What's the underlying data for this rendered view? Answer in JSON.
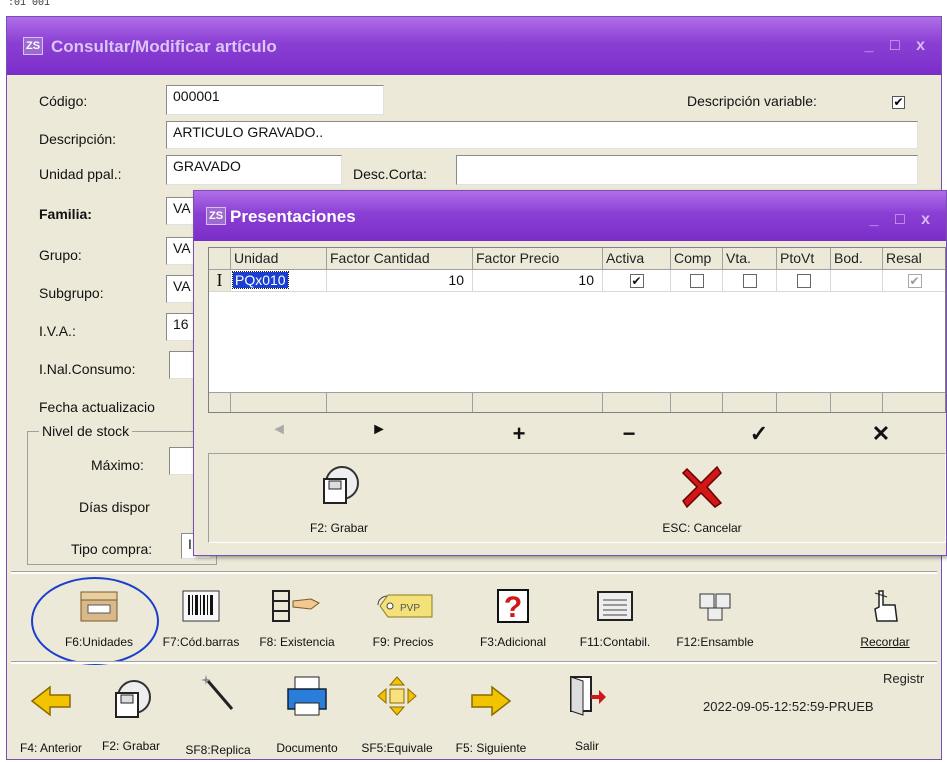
{
  "top_fragment": ":01 001",
  "main": {
    "title": "Consultar/Modificar artículo",
    "icon_text": "ZS",
    "window_buttons": "_ □ x",
    "fields": {
      "codigo_label": "Código:",
      "codigo_value": "000001",
      "desc_variable_label": "Descripción variable:",
      "desc_variable_checked": "✔",
      "descripcion_label": "Descripción:",
      "descripcion_value": "ARTICULO GRAVADO..",
      "unidad_label": "Unidad ppal.:",
      "unidad_value": "GRAVADO",
      "desc_corta_label": "Desc.Corta:",
      "desc_corta_value": "",
      "familia_label": "Familia:",
      "familia_value": "VA",
      "grupo_label": "Grupo:",
      "grupo_value": "VA",
      "subgrupo_label": "Subgrupo:",
      "subgrupo_value": "VA",
      "iva_label": "I.V.A.:",
      "iva_value": "16",
      "consumo_label": "I.Nal.Consumo:",
      "fecha_label": "Fecha actualizacio",
      "nivel_stock_label": "Nivel de stock",
      "maximo_label": "Máximo:",
      "dias_label": "Días dispor",
      "tipo_compra_label": "Tipo compra:",
      "tipo_compra_value": "I"
    },
    "toolbar1": [
      {
        "key": "units",
        "label": "F6:Unidades"
      },
      {
        "key": "barcode",
        "label": "F7:Cód.barras"
      },
      {
        "key": "stock",
        "label": "F8: Existencia"
      },
      {
        "key": "prices",
        "label": "F9: Precios"
      },
      {
        "key": "additional",
        "label": "F3:Adicional"
      },
      {
        "key": "accounting",
        "label": "F11:Contabil."
      },
      {
        "key": "assembly",
        "label": "F12:Ensamble"
      },
      {
        "key": "remind",
        "label": "Recordar"
      }
    ],
    "toolbar2": [
      {
        "key": "prev",
        "label": "F4: Anterior"
      },
      {
        "key": "save",
        "label": "F2: Grabar"
      },
      {
        "key": "replicate",
        "label": "SF8:Replica"
      },
      {
        "key": "document",
        "label": "Documento"
      },
      {
        "key": "equivalent",
        "label": "SF5:Equivale"
      },
      {
        "key": "next",
        "label": "F5: Siguiente"
      },
      {
        "key": "exit",
        "label": "Salir"
      }
    ],
    "registro_label": "Registr",
    "registro_value": "2022-09-05-12:52:59-PRUEB"
  },
  "dialog": {
    "title": "Presentaciones",
    "icon_text": "ZS",
    "window_buttons": "_ □ x",
    "columns": [
      "Unidad",
      "Factor Cantidad",
      "Factor Precio",
      "Activa",
      "Comp",
      "Vta.",
      "PtoVt",
      "Bod.",
      "Resal"
    ],
    "row": {
      "indicator": "I",
      "unidad": "PQx010",
      "factor_cantidad": "10",
      "factor_precio": "10",
      "activa": "✔",
      "resal": "✔"
    },
    "nav": [
      "◄",
      "►",
      "+",
      "−",
      "✓",
      "✕"
    ],
    "save_label": "F2: Grabar",
    "cancel_label": "ESC: Cancelar"
  },
  "colors": {
    "title_gradient_top": "#b06ee8",
    "title_gradient_bottom": "#7a2ec8",
    "window_bg": "#ece9d8",
    "highlight_circle": "#1a3fd0",
    "cancel_red": "#d01818",
    "arrow_yellow": "#f2c400"
  }
}
